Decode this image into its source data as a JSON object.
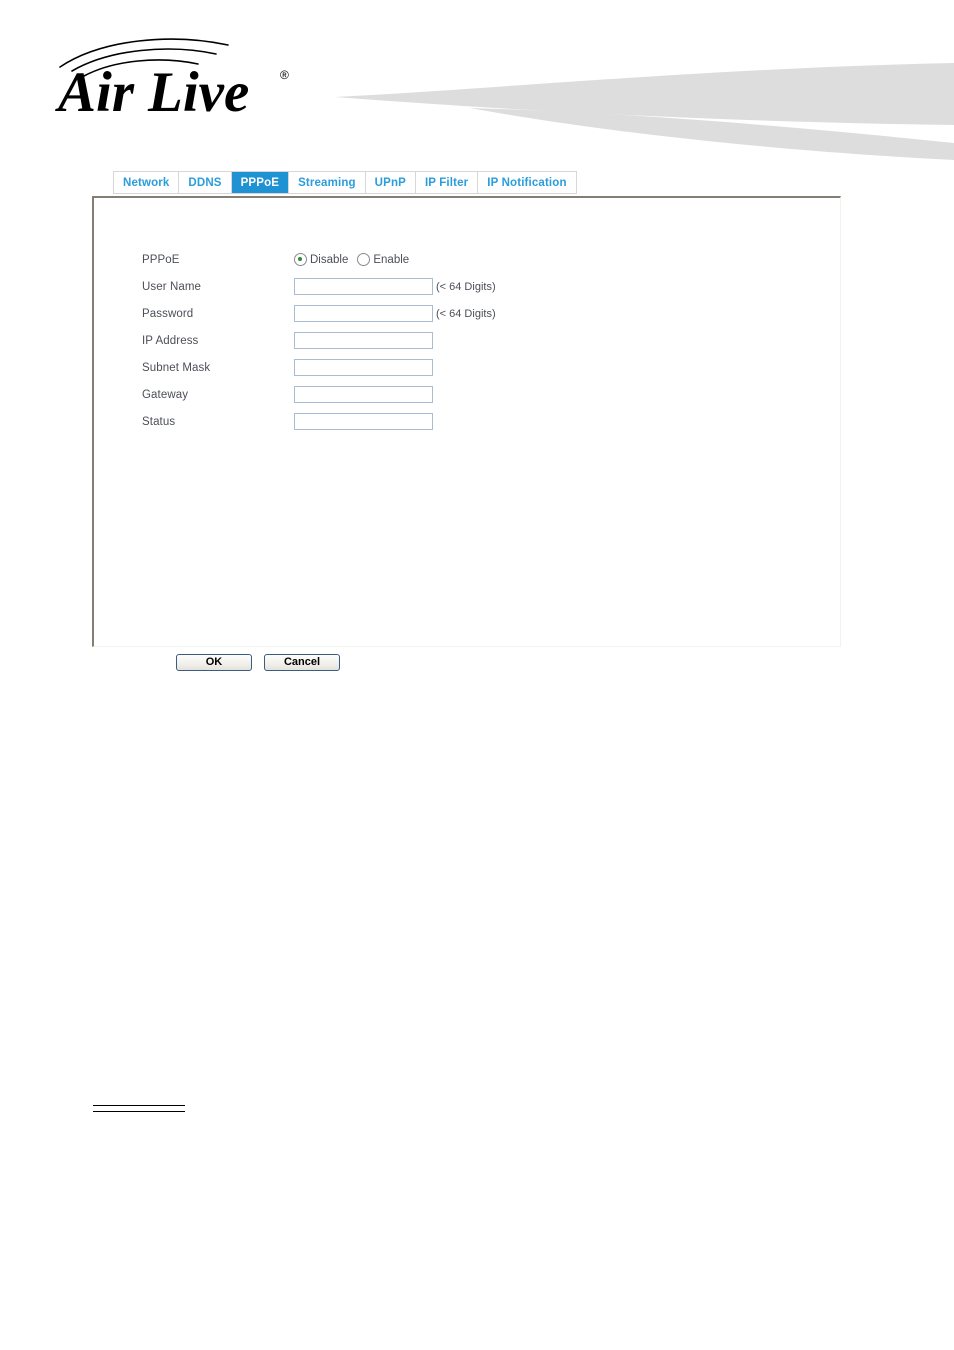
{
  "brand": {
    "name": "Air Live",
    "word_air": "Air",
    "word_live": "Live",
    "trademark": "®"
  },
  "tabs": [
    {
      "label": "Network",
      "active": false
    },
    {
      "label": "DDNS",
      "active": false
    },
    {
      "label": "PPPoE",
      "active": true
    },
    {
      "label": "Streaming",
      "active": false
    },
    {
      "label": "UPnP",
      "active": false
    },
    {
      "label": "IP Filter",
      "active": false
    },
    {
      "label": "IP Notification",
      "active": false
    }
  ],
  "form": {
    "pppoe": {
      "label": "PPPoE",
      "options": [
        {
          "label": "Disable",
          "selected": true
        },
        {
          "label": "Enable",
          "selected": false
        }
      ]
    },
    "user_name": {
      "label": "User Name",
      "value": "",
      "hint": "(< 64 Digits)"
    },
    "password": {
      "label": "Password",
      "value": "",
      "hint": "(< 64 Digits)"
    },
    "ip_address": {
      "label": "IP Address",
      "value": ""
    },
    "subnet_mask": {
      "label": "Subnet Mask",
      "value": ""
    },
    "gateway": {
      "label": "Gateway",
      "value": ""
    },
    "status": {
      "label": "Status",
      "value": ""
    }
  },
  "buttons": {
    "ok": "OK",
    "cancel": "Cancel"
  },
  "colors": {
    "tab_active_bg": "#1e92d2",
    "tab_text": "#2a9ddb",
    "label_text": "#4c4f56",
    "input_border": "#a9bcd0",
    "radio_selected": "#2f8b2f",
    "panel_border": "#837f74",
    "swoosh": "#dcdcdc"
  }
}
